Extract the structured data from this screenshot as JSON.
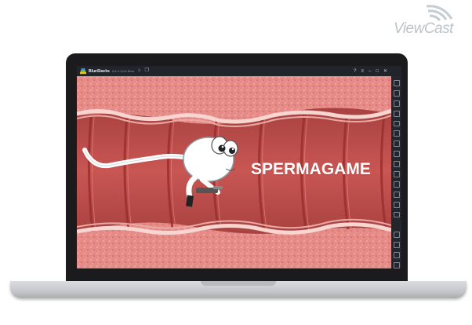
{
  "watermark": {
    "text": "ViewCast"
  },
  "emulator": {
    "app_name": "BlueStacks",
    "version": "5.6.0.1126 Beta",
    "titlebar_icons": [
      "home-icon",
      "multi-instance-icon"
    ],
    "window_controls": [
      "help-icon",
      "menu-icon",
      "minimize-icon",
      "maximize-icon",
      "close-icon"
    ],
    "sidebar_icons": [
      "fullscreen-icon",
      "volume-up-icon",
      "volume-down-icon",
      "screen-record-icon",
      "keyboard-icon",
      "screenshot-icon",
      "rotate-icon",
      "gamepad-icon",
      "macro-icon",
      "folder-icon",
      "copy-icon",
      "location-icon",
      "eco-mode-icon",
      "sync-icon",
      "settings-icon",
      "back-icon",
      "home-icon",
      "recents-icon"
    ]
  },
  "game": {
    "title": "SPERMAGAME",
    "colors": {
      "tissue": "#e58a86",
      "channel": "#c04b49",
      "ring": "#a83836",
      "membrane": "#f7d6d2",
      "text": "#ffffff"
    }
  }
}
